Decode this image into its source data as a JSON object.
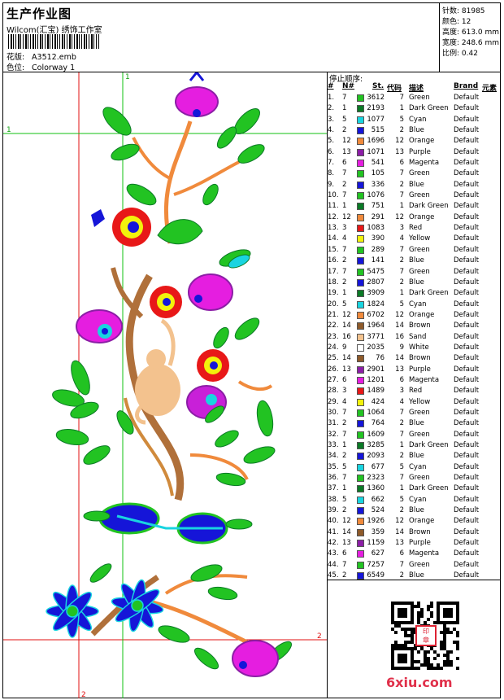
{
  "header": {
    "title": "生产作业图",
    "subtitle": "Wilcom(汇宝) 绣饰工作室",
    "design_label": "花版:",
    "design_value": "A3512.emb",
    "colorway_label": "色位:",
    "colorway_value": "Colorway 1"
  },
  "specs": {
    "stitches": "针数: 81985",
    "colors": "颜色: 12",
    "height": "高度: 613.0 mm",
    "width": "宽度: 248.6 mm",
    "scale": "比例: 0.42"
  },
  "design_markers": {
    "top_1": "1",
    "left_1": "1",
    "right_2": "2",
    "bottom_2": "2"
  },
  "stop_list": {
    "title": "停止顺序:",
    "headers": {
      "idx": "#",
      "needle": "N#",
      "stitches": "St.",
      "code": "代码",
      "desc": "描述",
      "brand": "Brand",
      "element": "元素"
    },
    "rows": [
      {
        "idx": "1.",
        "nn": "7",
        "st": "3612",
        "code": "7",
        "desc": "Green",
        "brand": "Default",
        "color": "#22c322"
      },
      {
        "idx": "2.",
        "nn": "1",
        "st": "2193",
        "code": "1",
        "desc": "Dark Green",
        "brand": "Default",
        "color": "#0b7a26"
      },
      {
        "idx": "3.",
        "nn": "5",
        "st": "1077",
        "code": "5",
        "desc": "Cyan",
        "brand": "Default",
        "color": "#19d4e0"
      },
      {
        "idx": "4.",
        "nn": "2",
        "st": "515",
        "code": "2",
        "desc": "Blue",
        "brand": "Default",
        "color": "#1515d8"
      },
      {
        "idx": "5.",
        "nn": "12",
        "st": "1696",
        "code": "12",
        "desc": "Orange",
        "brand": "Default",
        "color": "#f08a3c"
      },
      {
        "idx": "6.",
        "nn": "13",
        "st": "1071",
        "code": "13",
        "desc": "Purple",
        "brand": "Default",
        "color": "#8c1ea6"
      },
      {
        "idx": "7.",
        "nn": "6",
        "st": "541",
        "code": "6",
        "desc": "Magenta",
        "brand": "Default",
        "color": "#e51ee0"
      },
      {
        "idx": "8.",
        "nn": "7",
        "st": "105",
        "code": "7",
        "desc": "Green",
        "brand": "Default",
        "color": "#22c322"
      },
      {
        "idx": "9.",
        "nn": "2",
        "st": "336",
        "code": "2",
        "desc": "Blue",
        "brand": "Default",
        "color": "#1515d8"
      },
      {
        "idx": "10.",
        "nn": "7",
        "st": "1076",
        "code": "7",
        "desc": "Green",
        "brand": "Default",
        "color": "#22c322"
      },
      {
        "idx": "11.",
        "nn": "1",
        "st": "751",
        "code": "1",
        "desc": "Dark Green",
        "brand": "Default",
        "color": "#0b7a26"
      },
      {
        "idx": "12.",
        "nn": "12",
        "st": "291",
        "code": "12",
        "desc": "Orange",
        "brand": "Default",
        "color": "#f08a3c"
      },
      {
        "idx": "13.",
        "nn": "3",
        "st": "1083",
        "code": "3",
        "desc": "Red",
        "brand": "Default",
        "color": "#e81818"
      },
      {
        "idx": "14.",
        "nn": "4",
        "st": "390",
        "code": "4",
        "desc": "Yellow",
        "brand": "Default",
        "color": "#f2f20c"
      },
      {
        "idx": "15.",
        "nn": "7",
        "st": "289",
        "code": "7",
        "desc": "Green",
        "brand": "Default",
        "color": "#22c322"
      },
      {
        "idx": "16.",
        "nn": "2",
        "st": "141",
        "code": "2",
        "desc": "Blue",
        "brand": "Default",
        "color": "#1515d8"
      },
      {
        "idx": "17.",
        "nn": "7",
        "st": "5475",
        "code": "7",
        "desc": "Green",
        "brand": "Default",
        "color": "#22c322"
      },
      {
        "idx": "18.",
        "nn": "2",
        "st": "2807",
        "code": "2",
        "desc": "Blue",
        "brand": "Default",
        "color": "#1515d8"
      },
      {
        "idx": "19.",
        "nn": "1",
        "st": "3909",
        "code": "1",
        "desc": "Dark Green",
        "brand": "Default",
        "color": "#0b7a26"
      },
      {
        "idx": "20.",
        "nn": "5",
        "st": "1824",
        "code": "5",
        "desc": "Cyan",
        "brand": "Default",
        "color": "#19d4e0"
      },
      {
        "idx": "21.",
        "nn": "12",
        "st": "6702",
        "code": "12",
        "desc": "Orange",
        "brand": "Default",
        "color": "#f08a3c"
      },
      {
        "idx": "22.",
        "nn": "14",
        "st": "1964",
        "code": "14",
        "desc": "Brown",
        "brand": "Default",
        "color": "#8e5a2a"
      },
      {
        "idx": "23.",
        "nn": "16",
        "st": "3771",
        "code": "16",
        "desc": "Sand",
        "brand": "Default",
        "color": "#f3c28e"
      },
      {
        "idx": "24.",
        "nn": "9",
        "st": "2035",
        "code": "9",
        "desc": "White",
        "brand": "Default",
        "color": "#ffffff"
      },
      {
        "idx": "25.",
        "nn": "14",
        "st": "76",
        "code": "14",
        "desc": "Brown",
        "brand": "Default",
        "color": "#8e5a2a"
      },
      {
        "idx": "26.",
        "nn": "13",
        "st": "2901",
        "code": "13",
        "desc": "Purple",
        "brand": "Default",
        "color": "#8c1ea6"
      },
      {
        "idx": "27.",
        "nn": "6",
        "st": "1201",
        "code": "6",
        "desc": "Magenta",
        "brand": "Default",
        "color": "#e51ee0"
      },
      {
        "idx": "28.",
        "nn": "3",
        "st": "1489",
        "code": "3",
        "desc": "Red",
        "brand": "Default",
        "color": "#e81818"
      },
      {
        "idx": "29.",
        "nn": "4",
        "st": "424",
        "code": "4",
        "desc": "Yellow",
        "brand": "Default",
        "color": "#f2f20c"
      },
      {
        "idx": "30.",
        "nn": "7",
        "st": "1064",
        "code": "7",
        "desc": "Green",
        "brand": "Default",
        "color": "#22c322"
      },
      {
        "idx": "31.",
        "nn": "2",
        "st": "764",
        "code": "2",
        "desc": "Blue",
        "brand": "Default",
        "color": "#1515d8"
      },
      {
        "idx": "32.",
        "nn": "7",
        "st": "1609",
        "code": "7",
        "desc": "Green",
        "brand": "Default",
        "color": "#22c322"
      },
      {
        "idx": "33.",
        "nn": "1",
        "st": "3285",
        "code": "1",
        "desc": "Dark Green",
        "brand": "Default",
        "color": "#0b7a26"
      },
      {
        "idx": "34.",
        "nn": "2",
        "st": "2093",
        "code": "2",
        "desc": "Blue",
        "brand": "Default",
        "color": "#1515d8"
      },
      {
        "idx": "35.",
        "nn": "5",
        "st": "677",
        "code": "5",
        "desc": "Cyan",
        "brand": "Default",
        "color": "#19d4e0"
      },
      {
        "idx": "36.",
        "nn": "7",
        "st": "2323",
        "code": "7",
        "desc": "Green",
        "brand": "Default",
        "color": "#22c322"
      },
      {
        "idx": "37.",
        "nn": "1",
        "st": "1360",
        "code": "1",
        "desc": "Dark Green",
        "brand": "Default",
        "color": "#0b7a26"
      },
      {
        "idx": "38.",
        "nn": "5",
        "st": "662",
        "code": "5",
        "desc": "Cyan",
        "brand": "Default",
        "color": "#19d4e0"
      },
      {
        "idx": "39.",
        "nn": "2",
        "st": "524",
        "code": "2",
        "desc": "Blue",
        "brand": "Default",
        "color": "#1515d8"
      },
      {
        "idx": "40.",
        "nn": "12",
        "st": "1926",
        "code": "12",
        "desc": "Orange",
        "brand": "Default",
        "color": "#f08a3c"
      },
      {
        "idx": "41.",
        "nn": "14",
        "st": "359",
        "code": "14",
        "desc": "Brown",
        "brand": "Default",
        "color": "#8e5a2a"
      },
      {
        "idx": "42.",
        "nn": "13",
        "st": "1159",
        "code": "13",
        "desc": "Purple",
        "brand": "Default",
        "color": "#8c1ea6"
      },
      {
        "idx": "43.",
        "nn": "6",
        "st": "627",
        "code": "6",
        "desc": "Magenta",
        "brand": "Default",
        "color": "#e51ee0"
      },
      {
        "idx": "44.",
        "nn": "7",
        "st": "7257",
        "code": "7",
        "desc": "Green",
        "brand": "Default",
        "color": "#22c322"
      },
      {
        "idx": "45.",
        "nn": "2",
        "st": "6549",
        "code": "2",
        "desc": "Blue",
        "brand": "Default",
        "color": "#1515d8"
      }
    ]
  },
  "footer": {
    "watermark": "6xiu.com",
    "stamp": "印章"
  }
}
